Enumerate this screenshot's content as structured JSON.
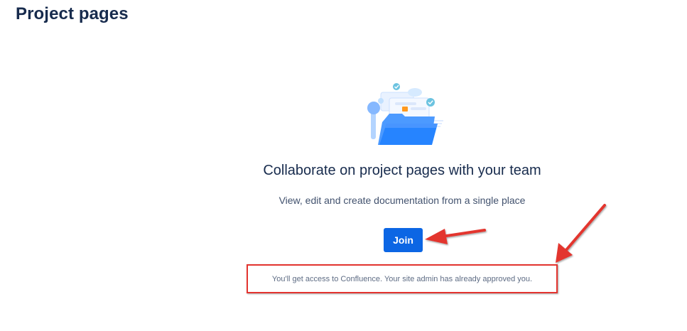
{
  "page": {
    "title": "Project pages"
  },
  "empty_state": {
    "headline": "Collaborate on project pages with your team",
    "description": "View, edit and create documentation from a single place",
    "join_label": "Join",
    "access_note": "You'll get access to Confluence. Your site admin has already approved you.",
    "illustration_icon": "documents-folder-illustration"
  },
  "colors": {
    "primary_button": "#0c66e4",
    "heading_text": "#172b4d",
    "annotation_red": "#e3342f"
  }
}
